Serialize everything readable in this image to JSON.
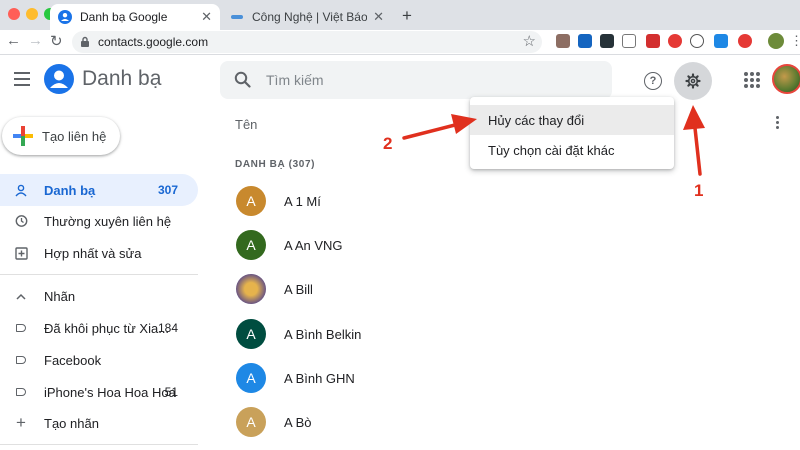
{
  "browser": {
    "tabs": [
      {
        "title": "Danh bạ Google",
        "active": true
      },
      {
        "title": "Công Nghệ | Việt Báo",
        "active": false
      }
    ],
    "url": "contacts.google.com"
  },
  "header": {
    "app_title": "Danh bạ",
    "search_placeholder": "Tìm kiếm"
  },
  "sidebar": {
    "create_label": "Tạo liên hệ",
    "items": [
      {
        "label": "Danh bạ",
        "count": "307",
        "icon": "person-icon"
      },
      {
        "label": "Thường xuyên liên hệ",
        "count": "",
        "icon": "history-icon"
      },
      {
        "label": "Hợp nhất và sửa",
        "count": "",
        "icon": "merge-icon"
      }
    ],
    "labels_header": "Nhãn",
    "labels": [
      {
        "label": "Đã khôi phục từ Xia...",
        "count": "184"
      },
      {
        "label": "Facebook",
        "count": ""
      },
      {
        "label": "iPhone's Hoa Hoa Hoa",
        "count": "51"
      }
    ],
    "create_label_item": "Tạo nhãn"
  },
  "main": {
    "column_header": "Tên",
    "section_label": "DANH BẠ (307)",
    "contacts": [
      {
        "name": "A 1 Mí",
        "initial": "A",
        "color": "#c8892e"
      },
      {
        "name": "A An VNG",
        "initial": "A",
        "color": "#33691e"
      },
      {
        "name": "A Bill",
        "initial": "",
        "color": "#b8860b"
      },
      {
        "name": "A Bình Belkin",
        "initial": "A",
        "color": "#004d40"
      },
      {
        "name": "A Bình GHN",
        "initial": "A",
        "color": "#1e88e5"
      },
      {
        "name": "A Bò",
        "initial": "A",
        "color": "#c9a15a"
      }
    ]
  },
  "menu": {
    "items": [
      "Hủy các thay đổi",
      "Tùy chọn cài đặt khác"
    ]
  },
  "annotations": [
    "1",
    "2"
  ],
  "colors": {
    "accent": "#1a73e8",
    "arrow": "#e0301e"
  }
}
